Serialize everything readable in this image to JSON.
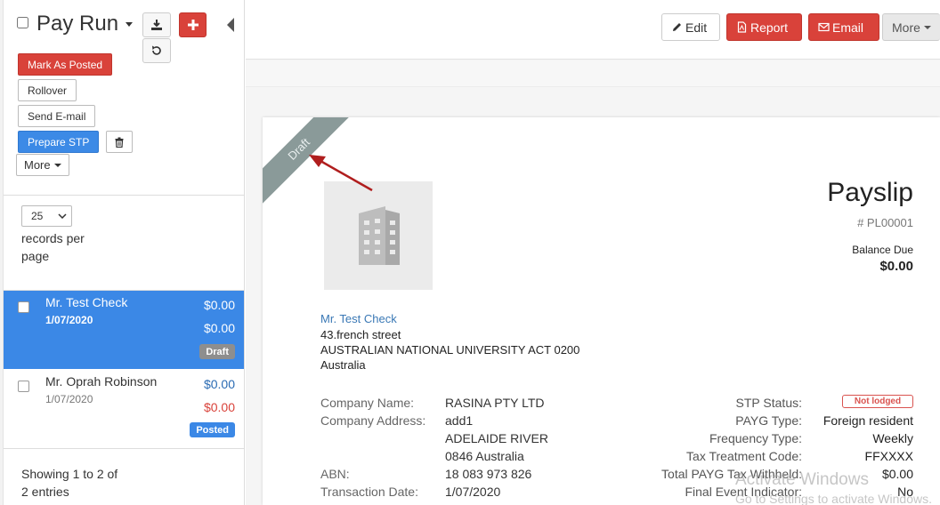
{
  "sidebar": {
    "title": "Pay Run",
    "buttons": {
      "mark_posted": "Mark As Posted",
      "rollover": "Rollover",
      "send_email": "Send E-mail",
      "prepare_stp": "Prepare STP",
      "more": "More"
    },
    "page_size": "25",
    "records_per_page": "records per page",
    "rows": [
      {
        "name": "Mr. Test Check",
        "date": "1/07/2020",
        "amount1": "$0.00",
        "amount2": "$0.00",
        "status": "Draft"
      },
      {
        "name": "Mr. Oprah Robinson",
        "date": "1/07/2020",
        "amount1": "$0.00",
        "amount2": "$0.00",
        "status": "Posted"
      }
    ],
    "footer": "Showing 1 to 2 of 2 entries"
  },
  "toolbar": {
    "edit": "Edit",
    "report": "Report",
    "email": "Email",
    "more": "More"
  },
  "payslip": {
    "ribbon": "Draft",
    "title": "Payslip",
    "number": "# PL00001",
    "balance_label": "Balance Due",
    "balance": "$0.00",
    "employee": {
      "name": "Mr. Test Check",
      "street": "43.french street",
      "city": "AUSTRALIAN NATIONAL UNIVERSITY ACT 0200",
      "country": "Australia"
    },
    "left_fields": {
      "company_name_label": "Company Name:",
      "company_name": "RASINA PTY LTD",
      "company_address_label": "Company Address:",
      "address1": "add1",
      "address2": "ADELAIDE RIVER",
      "address3": "0846 Australia",
      "abn_label": "ABN:",
      "abn": "18 083 973 826",
      "txn_date_label": "Transaction Date:",
      "txn_date": "1/07/2020"
    },
    "right_fields": {
      "stp_status_label": "STP Status:",
      "stp_status": "Not lodged",
      "payg_type_label": "PAYG Type:",
      "payg_type": "Foreign resident",
      "freq_label": "Frequency Type:",
      "freq": "Weekly",
      "tax_code_label": "Tax Treatment Code:",
      "tax_code": "FFXXXX",
      "payg_withheld_label": "Total PAYG Tax Withheld:",
      "payg_withheld": "$0.00",
      "final_event_label": "Final Event Indicator:",
      "final_event": "No"
    }
  },
  "watermark": {
    "line1": "Activate Windows",
    "line2": "Go to Settings to activate Windows."
  },
  "colors": {
    "red": "#d9423a",
    "blue": "#3b88e6",
    "ribbon": "#8a9a99",
    "link": "#3a78b5"
  }
}
